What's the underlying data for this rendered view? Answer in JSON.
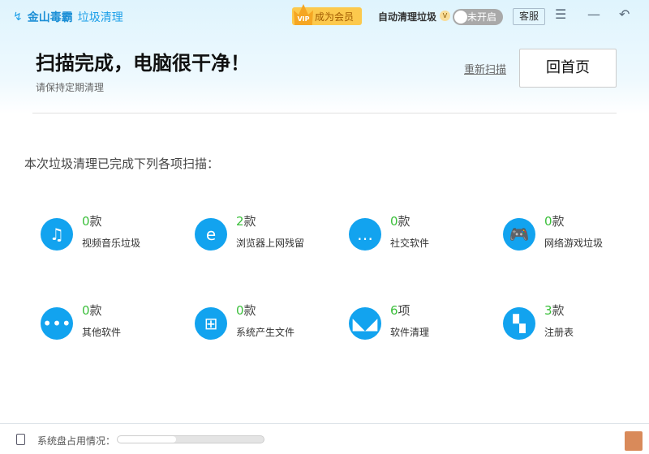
{
  "app": {
    "brand": "金山毒霸",
    "module": "垃圾清理"
  },
  "header": {
    "vip_label": "成为会员",
    "vip_badge": "VIP",
    "auto_clean_label": "自动清理垃圾",
    "auto_badge": "V",
    "toggle_label": "未开启",
    "service_label": "客服",
    "menu_icon": "☰",
    "minimize_icon": "—",
    "back_icon": "↶"
  },
  "result": {
    "title": "扫描完成，电脑很干净！",
    "subtitle": "请保持定期清理",
    "rescan": "重新扫描",
    "home": "回首页"
  },
  "intro": "本次垃圾清理已完成下列各项扫描：",
  "items": [
    {
      "count": "0",
      "unit": "款",
      "name": "视频音乐垃圾",
      "icon": "♫"
    },
    {
      "count": "2",
      "unit": "款",
      "name": "浏览器上网残留",
      "icon": "e"
    },
    {
      "count": "0",
      "unit": "款",
      "name": "社交软件",
      "icon": "…"
    },
    {
      "count": "0",
      "unit": "款",
      "name": "网络游戏垃圾",
      "icon": "🎮"
    },
    {
      "count": "0",
      "unit": "款",
      "name": "其他软件",
      "icon": "•••"
    },
    {
      "count": "0",
      "unit": "款",
      "name": "系统产生文件",
      "icon": "⊞"
    },
    {
      "count": "6",
      "unit": "项",
      "name": "软件清理",
      "icon": "◣◢"
    },
    {
      "count": "3",
      "unit": "款",
      "name": "注册表",
      "icon": "▚"
    }
  ],
  "footer": {
    "disk_label": "系统盘占用情况：",
    "disk_usage_percent": 40
  }
}
